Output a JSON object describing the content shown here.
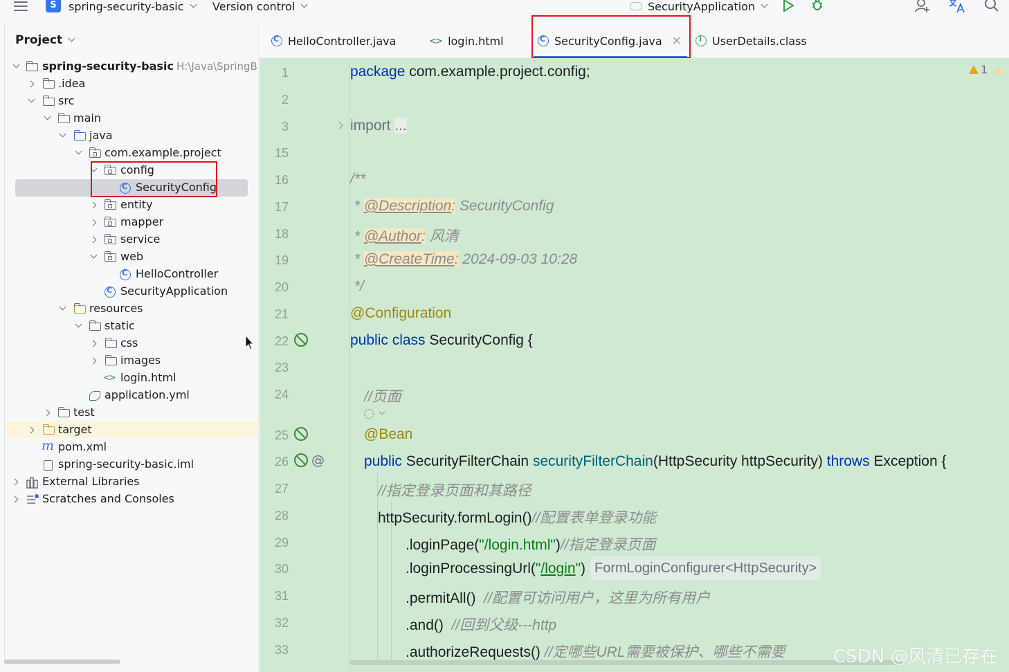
{
  "toolbar": {
    "project_badge": "S",
    "project_name": "spring-security-basic",
    "vcs_label": "Version control",
    "run_config": "SecurityApplication"
  },
  "project_panel": {
    "title": "Project",
    "root_name": "spring-security-basic",
    "root_path": "H:\\Java\\SpringB",
    "tree": [
      {
        "label": ".idea"
      },
      {
        "label": "src"
      },
      {
        "label": "main"
      },
      {
        "label": "java"
      },
      {
        "label": "com.example.project"
      },
      {
        "label": "config"
      },
      {
        "label": "SecurityConfig"
      },
      {
        "label": "entity"
      },
      {
        "label": "mapper"
      },
      {
        "label": "service"
      },
      {
        "label": "web"
      },
      {
        "label": "HelloController"
      },
      {
        "label": "SecurityApplication"
      },
      {
        "label": "resources"
      },
      {
        "label": "static"
      },
      {
        "label": "css"
      },
      {
        "label": "images"
      },
      {
        "label": "login.html"
      },
      {
        "label": "application.yml"
      },
      {
        "label": "test"
      },
      {
        "label": "target"
      },
      {
        "label": "pom.xml"
      },
      {
        "label": "spring-security-basic.iml"
      },
      {
        "label": "External Libraries"
      },
      {
        "label": "Scratches and Consoles"
      }
    ],
    "html_icon": "<>",
    "maven_icon": "m"
  },
  "tabs": [
    {
      "label": "HelloController.java"
    },
    {
      "label": "login.html"
    },
    {
      "label": "SecurityConfig.java"
    },
    {
      "label": "UserDetails.class"
    }
  ],
  "tab_html_icon": "<>",
  "tab_close": "×",
  "inspections": {
    "warnings": "1"
  },
  "editor": {
    "line_numbers": [
      "1",
      "2",
      "3",
      "15",
      "16",
      "17",
      "18",
      "19",
      "20",
      "21",
      "22",
      "23",
      "24",
      "25",
      "26",
      "27",
      "28",
      "29",
      "30",
      "31",
      "32",
      "33"
    ],
    "l1_kw": "package",
    "l1_rest": " com.example.project.config;",
    "l3_kw": "import",
    "l3_dots": "...",
    "l16": "/**",
    "l17_star": " * ",
    "l17_tag": "@Description",
    "l17_colon": ":",
    "l17_text": " SecurityConfig",
    "l18_star": " * ",
    "l18_tag": "@Author",
    "l18_colon": ":",
    "l18_text": " 风清",
    "l19_star": " * ",
    "l19_tag": "@CreateTime",
    "l19_colon": ":",
    "l19_text": " 2024-09-03 10:28",
    "l20": " */",
    "l21": "@Configuration",
    "l22_kw": "public class",
    "l22_rest": " SecurityConfig {",
    "l24": "//页面",
    "l25": "@Bean",
    "l26_kw": "public",
    "l26_type": " SecurityFilterChain ",
    "l26_fn": "securityFilterChain",
    "l26_params": "(HttpSecurity httpSecurity) ",
    "l26_throws": "throws",
    "l26_exc": " Exception {",
    "l27": "//指定登录页面和其路径",
    "l28_code": "httpSecurity.formLogin()",
    "l28_cmt": "//配置表单登录功能",
    "l29_code": ".loginPage(",
    "l29_str": "\"/login.html\"",
    "l29_close": ")",
    "l29_cmt": "//指定登录页面",
    "l30_code": ".loginProcessingUrl(",
    "l30_q1": "\"",
    "l30_url": "/login",
    "l30_q2": "\"",
    "l30_close": ")",
    "l30_hint": "FormLoginConfigurer<HttpSecurity>",
    "l31_code": ".permitAll()",
    "l31_cmt": "  //配置可访问用户，这里为所有用户",
    "l32_code": ".and()",
    "l32_cmt": "  //回到父级---http",
    "l33_code": ".authorizeRequests()",
    "l33_cmt": " //定哪些URL需要被保护、哪些不需要"
  },
  "watermark": "CSDN @风清已存在",
  "colors": {
    "accent": "#3574f0",
    "highlight_box": "#e3151d",
    "editor_bg": "#cfe9d2"
  }
}
